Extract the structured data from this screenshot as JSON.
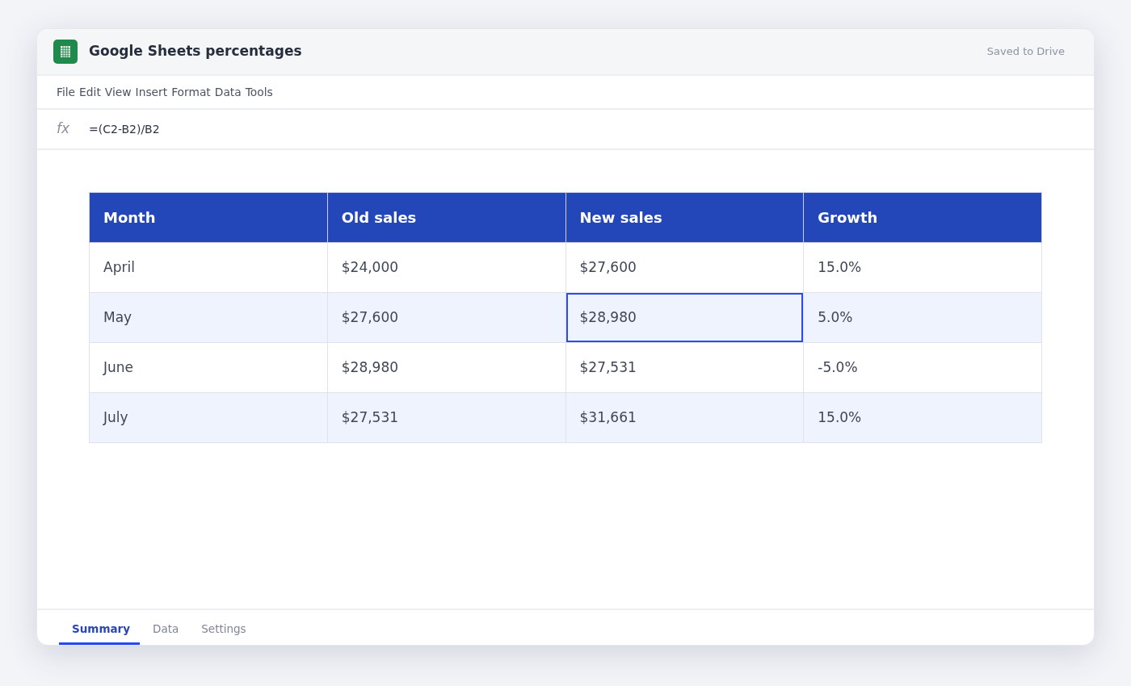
{
  "window": {
    "title": "Google Sheets percentages",
    "save_status": "Saved to Drive"
  },
  "menu": [
    "File",
    "Edit",
    "View",
    "Insert",
    "Format",
    "Data",
    "Tools"
  ],
  "formula_bar": {
    "label": "fx",
    "value": "=(C2-B2)/B2"
  },
  "table": {
    "columns": [
      "Month",
      "Old sales",
      "New sales",
      "Growth"
    ],
    "rows": [
      {
        "cells": [
          {
            "text": "April",
            "selected": false
          },
          {
            "text": "$24,000",
            "selected": false
          },
          {
            "text": "$27,600",
            "selected": false
          },
          {
            "text": "15.0%",
            "selected": false
          }
        ]
      },
      {
        "cells": [
          {
            "text": "May",
            "selected": false
          },
          {
            "text": "$27,600",
            "selected": false
          },
          {
            "text": "$28,980",
            "selected": true
          },
          {
            "text": "5.0%",
            "selected": false
          }
        ]
      },
      {
        "cells": [
          {
            "text": "June",
            "selected": false
          },
          {
            "text": "$28,980",
            "selected": false
          },
          {
            "text": "$27,531",
            "selected": false
          },
          {
            "text": "-5.0%",
            "selected": false
          }
        ]
      },
      {
        "cells": [
          {
            "text": "July",
            "selected": false
          },
          {
            "text": "$27,531",
            "selected": false
          },
          {
            "text": "$31,661",
            "selected": false
          },
          {
            "text": "15.0%",
            "selected": false
          }
        ]
      }
    ]
  },
  "sheet_tabs": [
    {
      "label": "Summary",
      "selected": true
    },
    {
      "label": "Data",
      "selected": false
    },
    {
      "label": "Settings",
      "selected": false
    }
  ]
}
